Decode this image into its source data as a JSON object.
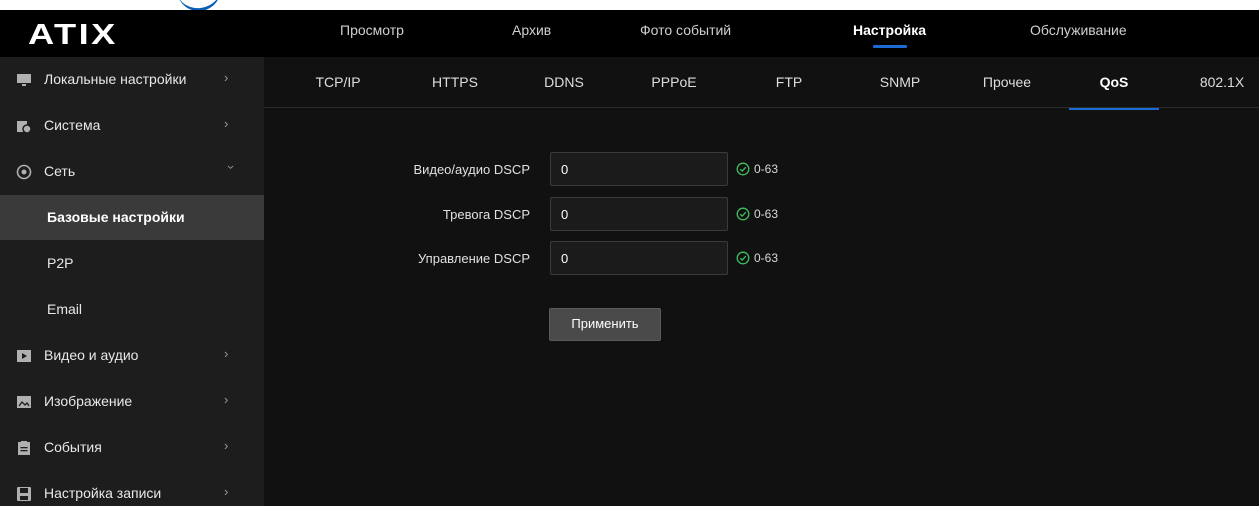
{
  "brand": {
    "logo_text": "ATIX"
  },
  "top_nav": [
    {
      "label": "Просмотр"
    },
    {
      "label": "Архив"
    },
    {
      "label": "Фото событий"
    },
    {
      "label": "Настройка",
      "active": true
    },
    {
      "label": "Обслуживание"
    }
  ],
  "sidebar": {
    "items": [
      {
        "label": "Локальные настройки",
        "icon": "monitor-icon",
        "chevron": "right"
      },
      {
        "label": "Система",
        "icon": "system-icon",
        "chevron": "right"
      },
      {
        "label": "Сеть",
        "icon": "network-icon",
        "chevron": "down"
      },
      {
        "label": "Базовые настройки",
        "sub": true,
        "active": true
      },
      {
        "label": "P2P",
        "sub": true
      },
      {
        "label": "Email",
        "sub": true
      },
      {
        "label": "Видео и аудио",
        "icon": "video-icon",
        "chevron": "right"
      },
      {
        "label": "Изображение",
        "icon": "image-icon",
        "chevron": "right"
      },
      {
        "label": "События",
        "icon": "events-icon",
        "chevron": "right"
      },
      {
        "label": "Настройка записи",
        "icon": "record-icon",
        "chevron": "right"
      }
    ]
  },
  "sub_tabs": [
    {
      "label": "TCP/IP"
    },
    {
      "label": "HTTPS"
    },
    {
      "label": "DDNS"
    },
    {
      "label": "PPPoE"
    },
    {
      "label": "FTP"
    },
    {
      "label": "SNMP"
    },
    {
      "label": "Прочее"
    },
    {
      "label": "QoS",
      "active": true
    },
    {
      "label": "802.1X"
    }
  ],
  "form": {
    "fields": [
      {
        "label": "Видео/аудио DSCP",
        "value": "0",
        "range": "0-63"
      },
      {
        "label": "Тревога DSCP",
        "value": "0",
        "range": "0-63"
      },
      {
        "label": "Управление DSCP",
        "value": "0",
        "range": "0-63"
      }
    ],
    "apply_label": "Применить"
  },
  "colors": {
    "accent": "#1c6bd4",
    "valid": "#3fbf5f",
    "sidebar_bg": "#1d1d1d",
    "main_bg": "#111111"
  }
}
